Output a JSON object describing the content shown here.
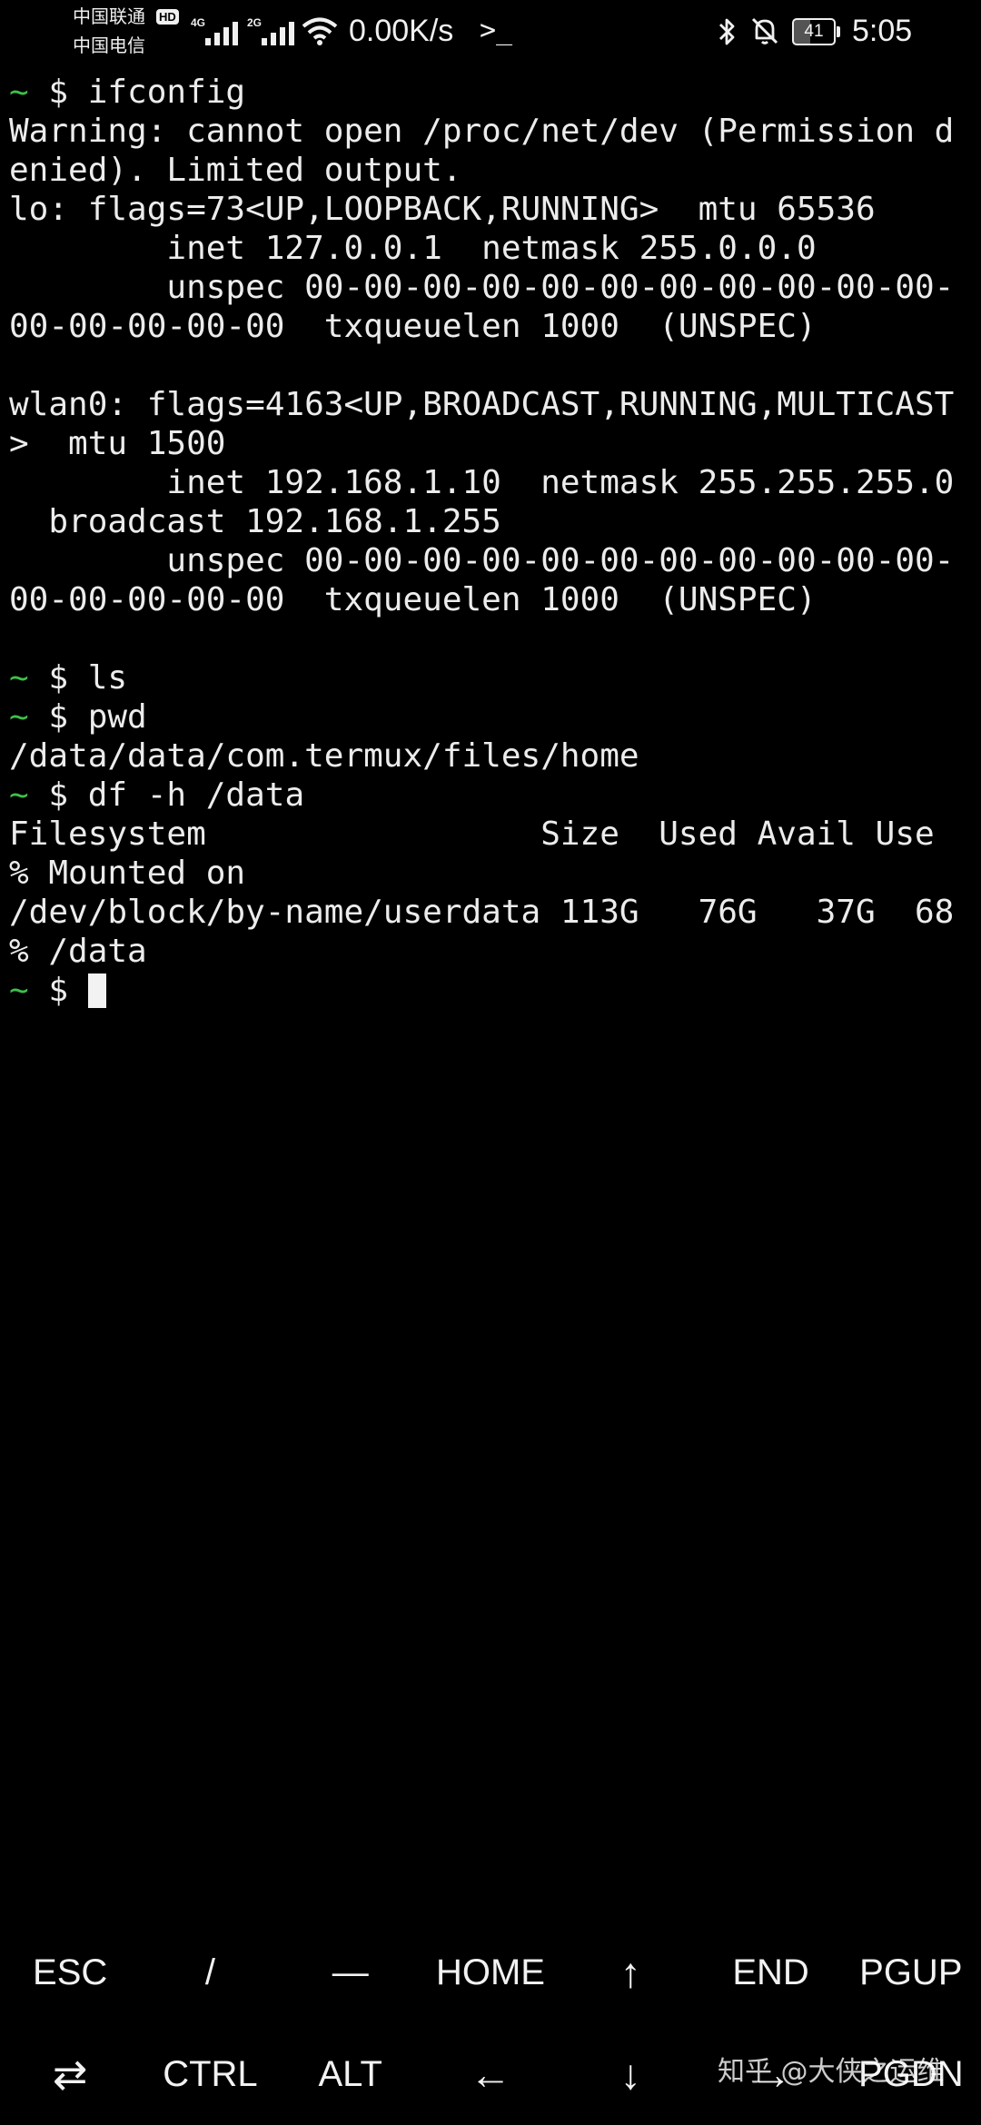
{
  "status_bar": {
    "carrier_1": "中国联通",
    "carrier_2": "中国电信",
    "hd_badge": "HD",
    "signal_1_gen": "4G",
    "signal_2_gen": "2G",
    "net_speed": "0.00K/s",
    "terminal_indicator": ">_",
    "battery_level": "41",
    "battery_fraction": 0.41,
    "time": "5:05",
    "icons": [
      "signal-icon",
      "wifi-icon",
      "bluetooth-icon",
      "mute-icon",
      "battery-icon"
    ]
  },
  "terminal": {
    "prompt_tilde": "~",
    "lines": [
      {
        "type": "prompt",
        "cmd": " $ ifconfig"
      },
      {
        "type": "output",
        "text": "Warning: cannot open /proc/net/dev (Permission d"
      },
      {
        "type": "output",
        "text": "enied). Limited output."
      },
      {
        "type": "output",
        "text": "lo: flags=73<UP,LOOPBACK,RUNNING>  mtu 65536"
      },
      {
        "type": "output",
        "text": "        inet 127.0.0.1  netmask 255.0.0.0"
      },
      {
        "type": "output",
        "text": "        unspec 00-00-00-00-00-00-00-00-00-00-00-"
      },
      {
        "type": "output",
        "text": "00-00-00-00-00  txqueuelen 1000  (UNSPEC)"
      },
      {
        "type": "output",
        "text": ""
      },
      {
        "type": "output",
        "text": "wlan0: flags=4163<UP,BROADCAST,RUNNING,MULTICAST"
      },
      {
        "type": "output",
        "text": ">  mtu 1500"
      },
      {
        "type": "output",
        "text": "        inet 192.168.1.10  netmask 255.255.255.0"
      },
      {
        "type": "output",
        "text": "  broadcast 192.168.1.255"
      },
      {
        "type": "output",
        "text": "        unspec 00-00-00-00-00-00-00-00-00-00-00-"
      },
      {
        "type": "output",
        "text": "00-00-00-00-00  txqueuelen 1000  (UNSPEC)"
      },
      {
        "type": "output",
        "text": ""
      },
      {
        "type": "prompt",
        "cmd": " $ ls"
      },
      {
        "type": "prompt",
        "cmd": " $ pwd"
      },
      {
        "type": "output",
        "text": "/data/data/com.termux/files/home"
      },
      {
        "type": "prompt",
        "cmd": " $ df -h /data"
      },
      {
        "type": "output",
        "text": "Filesystem                 Size  Used Avail Use"
      },
      {
        "type": "output",
        "text": "% Mounted on"
      },
      {
        "type": "output",
        "text": "/dev/block/by-name/userdata 113G   76G   37G  68"
      },
      {
        "type": "output",
        "text": "% /data"
      },
      {
        "type": "current",
        "cmd": " $ "
      }
    ]
  },
  "extra_keys": {
    "row1": [
      "ESC",
      "/",
      "—",
      "HOME",
      "↑",
      "END",
      "PGUP"
    ],
    "row2": [
      "⇄",
      "CTRL",
      "ALT",
      "←",
      "↓",
      "→",
      "PGDN"
    ]
  },
  "watermark": "知乎 @大侠之运维"
}
